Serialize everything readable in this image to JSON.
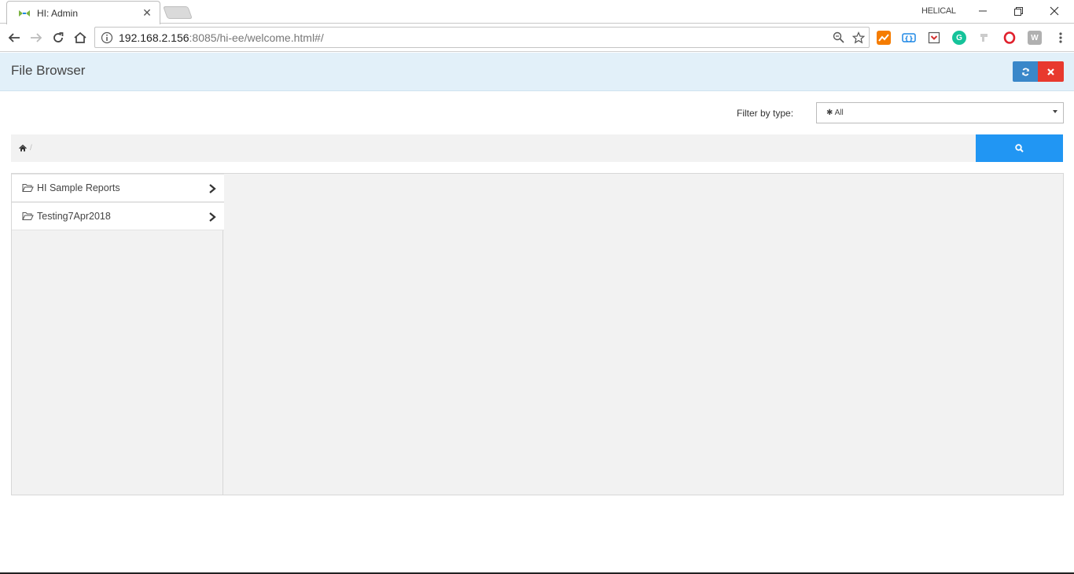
{
  "browser": {
    "tab_title": "HI: Admin",
    "profile_name": "HELICAL",
    "url_host": "192.168.2.156",
    "url_rest": ":8085/hi-ee/welcome.html#/"
  },
  "app": {
    "title": "File Browser",
    "filter_label": "Filter by type:",
    "filter_value": "✱ All",
    "breadcrumb_sep": "/",
    "folders": [
      {
        "label": "HI Sample Reports"
      },
      {
        "label": "Testing7Apr2018"
      }
    ]
  },
  "colors": {
    "header_bg": "#e2f0f9",
    "refresh_button": "#3a87c9",
    "close_button": "#e8392e",
    "search_button": "#2196f3"
  }
}
